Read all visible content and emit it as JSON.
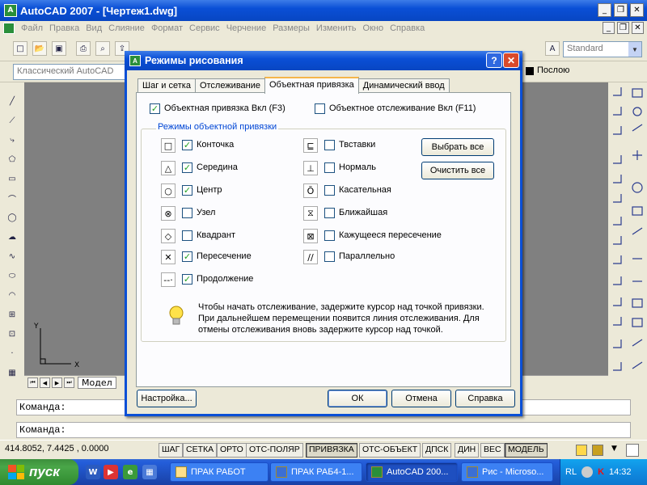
{
  "window": {
    "title": "AutoCAD 2007 - [Чертеж1.dwg]",
    "minimize": "_",
    "restore": "❐",
    "close": "✕"
  },
  "menubar": {
    "items": [
      "Файл",
      "Правка",
      "Вид",
      "Слияние",
      "Формат",
      "Сервис",
      "Черчение",
      "Размеры",
      "Изменить",
      "Окно",
      "Справка"
    ]
  },
  "toolbar": {
    "style_combo": "Standard",
    "workspace_combo": "Классический AutoCAD",
    "linetype_combo": "Послою"
  },
  "model_tab": "Модел",
  "command_line": {
    "line1": "Команда:",
    "line2": "Команда:"
  },
  "status": {
    "coordinates": "414.8052, 7.4425 , 0.0000",
    "buttons": [
      {
        "label": "ШАГ",
        "on": false
      },
      {
        "label": "СЕТКА",
        "on": false
      },
      {
        "label": "ОРТО",
        "on": false
      },
      {
        "label": "ОТС-ПОЛЯР",
        "on": false
      },
      {
        "label": "ПРИВЯЗКА",
        "on": true
      },
      {
        "label": "ОТС-ОБЪЕКТ",
        "on": false
      },
      {
        "label": "ДПСК",
        "on": false
      },
      {
        "label": "ДИН",
        "on": false
      },
      {
        "label": "ВЕС",
        "on": false
      },
      {
        "label": "МОДЕЛЬ",
        "on": true
      }
    ]
  },
  "dialog": {
    "title": "Режимы рисования",
    "help": "?",
    "tabs": [
      {
        "label": "Шаг и сетка",
        "selected": false
      },
      {
        "label": "Отслеживание",
        "selected": false
      },
      {
        "label": "Объектная привязка",
        "selected": true
      },
      {
        "label": "Динамический ввод",
        "selected": false
      }
    ],
    "osnap_on": {
      "label": "Объектная привязка Вкл (F3)",
      "checked": true
    },
    "otrack_on": {
      "label": "Объектное отслеживание Вкл (F11)",
      "checked": false
    },
    "group_title": "Режимы объектной привязки",
    "modes_left": [
      {
        "symbol": "□",
        "label": "Конточка",
        "checked": true
      },
      {
        "symbol": "△",
        "label": "Середина",
        "checked": true
      },
      {
        "symbol": "○",
        "label": "Центр",
        "checked": true
      },
      {
        "symbol": "⊗",
        "label": "Узел",
        "checked": false
      },
      {
        "symbol": "◇",
        "label": "Квадрант",
        "checked": false
      },
      {
        "symbol": "✕",
        "label": "Пересечение",
        "checked": true
      },
      {
        "symbol": "--·",
        "label": "Продолжение",
        "checked": true
      }
    ],
    "modes_right": [
      {
        "symbol": "⊑",
        "label": "Твставки",
        "checked": false
      },
      {
        "symbol": "⊥",
        "label": "Нормаль",
        "checked": false
      },
      {
        "symbol": "Ŏ",
        "label": "Касательная",
        "checked": false
      },
      {
        "symbol": "⧖",
        "label": "Ближайшая",
        "checked": false
      },
      {
        "symbol": "⊠",
        "label": "Кажущееся пересечение",
        "checked": false
      },
      {
        "symbol": "∕∕",
        "label": "Параллельно",
        "checked": false
      }
    ],
    "select_all": "Выбрать все",
    "clear_all": "Очистить все",
    "hint": "Чтобы начать отслеживание, задержите курсор над точкой привязки. При дальнейшем перемещении появится линия отслеживания. Для отмены отслеживания вновь задержите курсор над точкой.",
    "options_button": "Настройка...",
    "ok_button": "ОК",
    "cancel_button": "Отмена",
    "help_button": "Справка"
  },
  "taskbar": {
    "start": "пуск",
    "tasks": [
      {
        "label": "ПРАК РАБОТ",
        "active": false
      },
      {
        "label": "ПРАК РАБ4-1...",
        "active": false
      },
      {
        "label": "AutoCAD 200...",
        "active": true
      },
      {
        "label": "Рис - Microso...",
        "active": false
      }
    ],
    "lang": "RL",
    "clock": "14:32"
  },
  "colors": {
    "xp_blue": "#0a4fd6",
    "checkmark": "#21a121",
    "group_title": "#0046d5",
    "drawing_bg": "#808080"
  }
}
